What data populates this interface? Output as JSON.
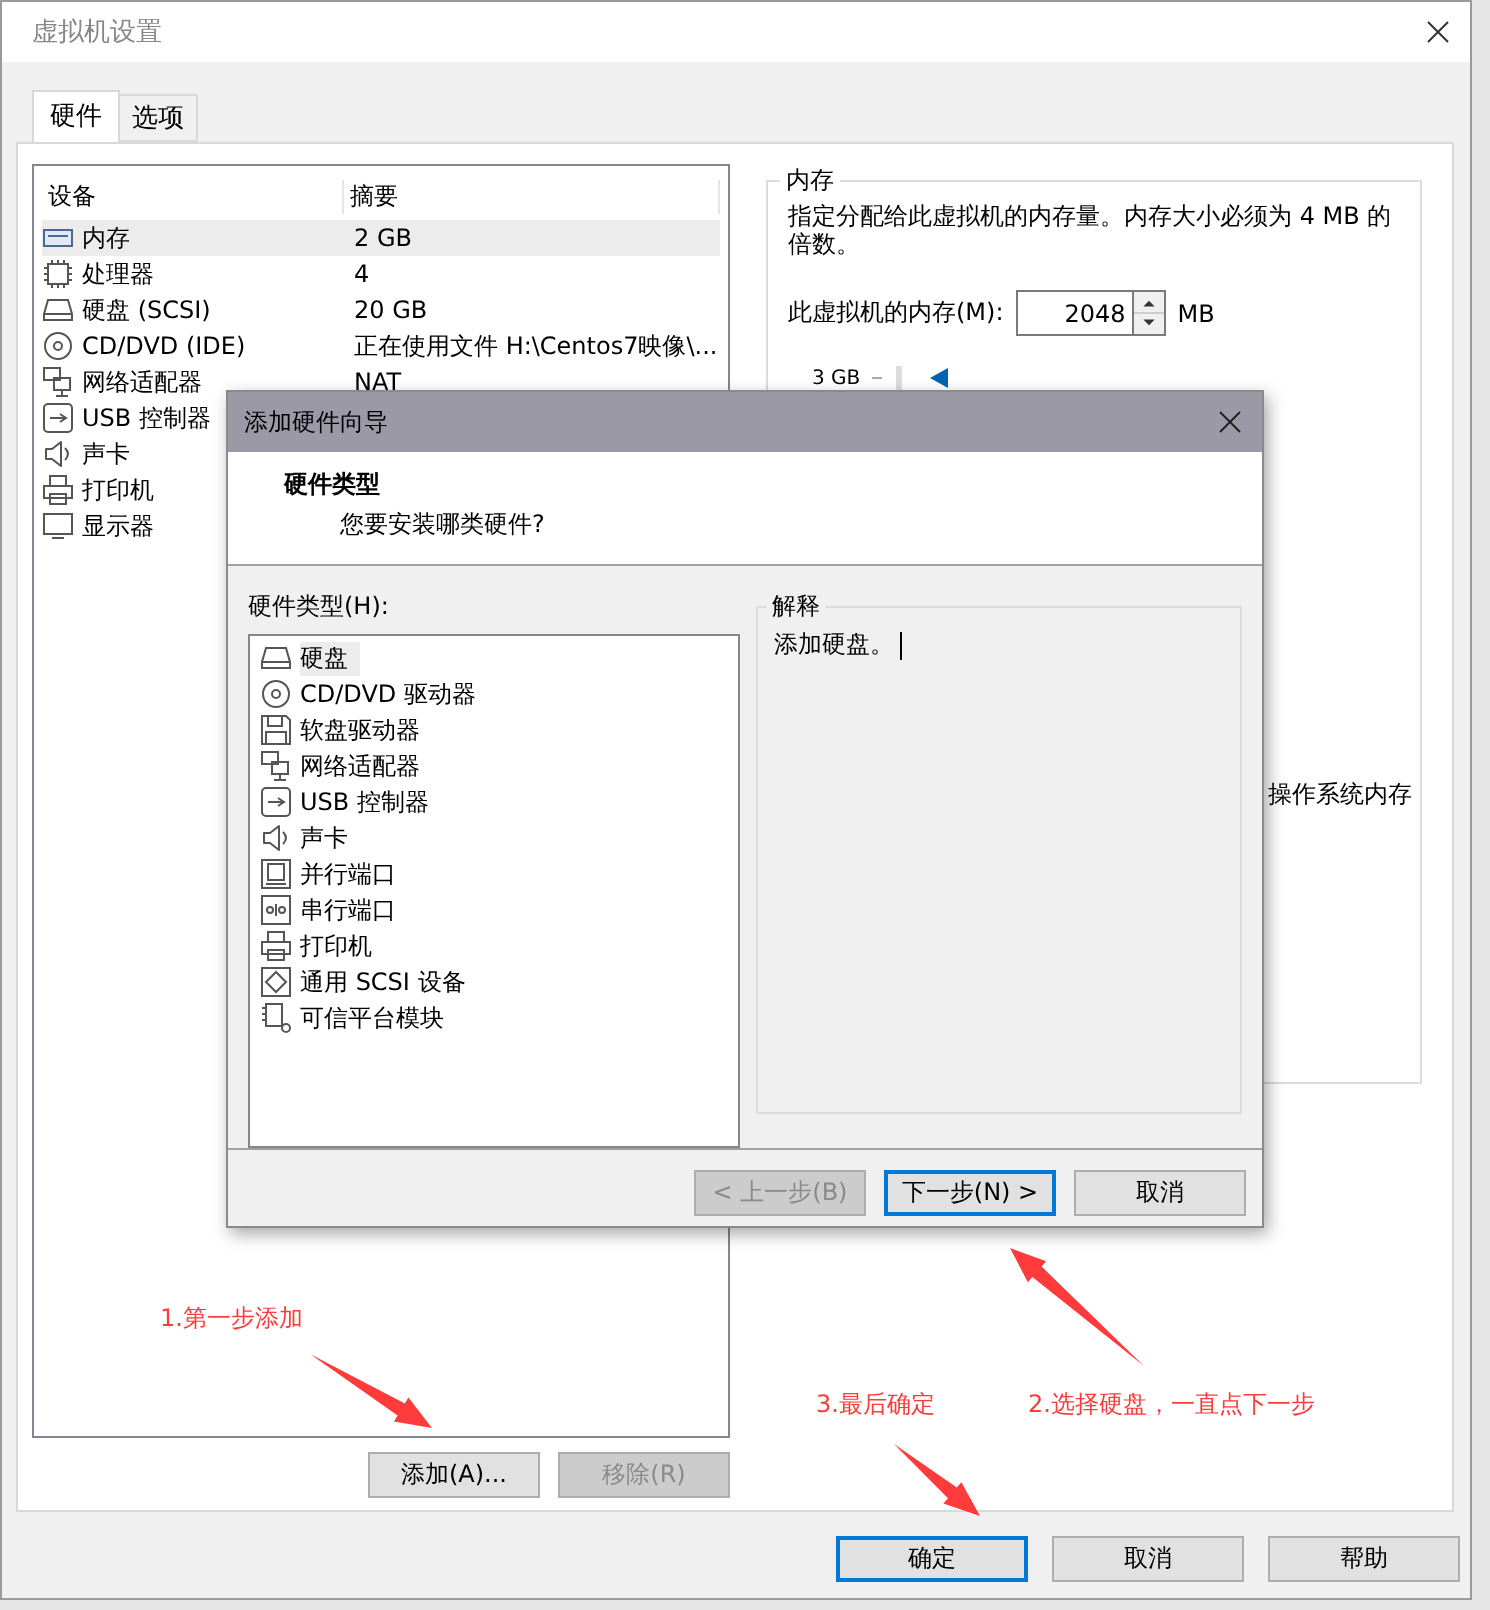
{
  "window": {
    "title": "虚拟机设置"
  },
  "tabs": [
    {
      "label": "硬件",
      "selected": true
    },
    {
      "label": "选项",
      "selected": false
    }
  ],
  "device_table": {
    "columns": [
      "设备",
      "摘要"
    ],
    "rows": [
      {
        "kind": "memory",
        "device": "内存",
        "summary": "2 GB",
        "selected": true
      },
      {
        "kind": "cpu",
        "device": "处理器",
        "summary": "4",
        "selected": false
      },
      {
        "kind": "disk",
        "device": "硬盘 (SCSI)",
        "summary": "20 GB",
        "selected": false
      },
      {
        "kind": "cd",
        "device": "CD/DVD (IDE)",
        "summary": "正在使用文件 H:\\Centos7映像\\...",
        "selected": false
      },
      {
        "kind": "network",
        "device": "网络适配器",
        "summary": "NAT",
        "selected": false
      },
      {
        "kind": "usb",
        "device": "USB 控制器",
        "selected": false
      },
      {
        "kind": "sound",
        "device": "声卡",
        "selected": false
      },
      {
        "kind": "printer",
        "device": "打印机",
        "selected": false
      },
      {
        "kind": "display",
        "device": "显示器",
        "selected": false
      }
    ]
  },
  "device_buttons": [
    {
      "label": "添加(A)...",
      "disabled": false
    },
    {
      "label": "移除(R)",
      "disabled": true
    }
  ],
  "memory_panel": {
    "title": "内存",
    "description": "指定分配给此虚拟机的内存量。内存大小必须为 4 MB 的倍数。",
    "field_label": "此虚拟机的内存(M):",
    "value": "2048",
    "unit": "MB",
    "scale_label": "3 GB",
    "note_fragment": "操作系统内存"
  },
  "footer_buttons": [
    {
      "label": "确定",
      "default": true
    },
    {
      "label": "取消",
      "default": false
    },
    {
      "label": "帮助",
      "default": false
    }
  ],
  "wizard": {
    "title": "添加硬件向导",
    "heading": "硬件类型",
    "subheading": "您要安装哪类硬件?",
    "list_label": "硬件类型(H):",
    "items": [
      {
        "kind": "disk",
        "label": "硬盘",
        "selected": true
      },
      {
        "kind": "cd",
        "label": "CD/DVD 驱动器",
        "selected": false
      },
      {
        "kind": "floppy",
        "label": "软盘驱动器",
        "selected": false
      },
      {
        "kind": "network",
        "label": "网络适配器",
        "selected": false
      },
      {
        "kind": "usb",
        "label": "USB 控制器",
        "selected": false
      },
      {
        "kind": "sound",
        "label": "声卡",
        "selected": false
      },
      {
        "kind": "parallel",
        "label": "并行端口",
        "selected": false
      },
      {
        "kind": "serial",
        "label": "串行端口",
        "selected": false
      },
      {
        "kind": "printer",
        "label": "打印机",
        "selected": false
      },
      {
        "kind": "scsi",
        "label": "通用 SCSI 设备",
        "selected": false
      },
      {
        "kind": "tpm",
        "label": "可信平台模块",
        "selected": false
      }
    ],
    "explanation_title": "解释",
    "explanation": "添加硬盘。",
    "buttons": [
      {
        "label": "< 上一步(B)",
        "disabled": true,
        "default": false
      },
      {
        "label": "下一步(N) >",
        "disabled": false,
        "default": true
      },
      {
        "label": "取消",
        "disabled": false,
        "default": false
      }
    ]
  },
  "annotations": [
    "1.第一步添加",
    "3.最后确定",
    "2.选择硬盘，一直点下一步"
  ]
}
